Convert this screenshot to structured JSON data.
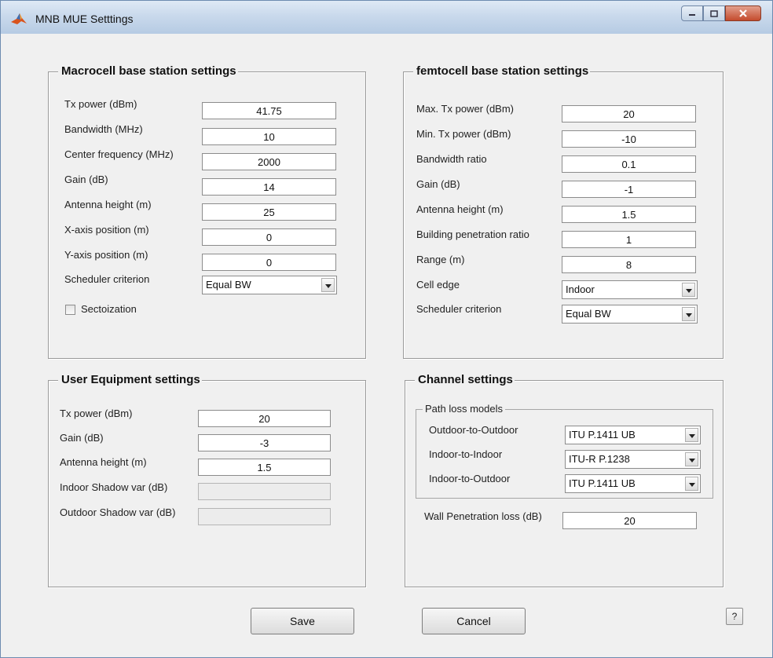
{
  "window": {
    "title": "MNB MUE Setttings",
    "icon": "matlab-logo-icon"
  },
  "macrocell": {
    "title": "Macrocell base station settings",
    "fields": [
      {
        "label": "Tx power (dBm)",
        "value": "41.75"
      },
      {
        "label": "Bandwidth (MHz)",
        "value": "10"
      },
      {
        "label": "Center frequency (MHz)",
        "value": "2000"
      },
      {
        "label": "Gain (dB)",
        "value": "14"
      },
      {
        "label": "Antenna height (m)",
        "value": "25"
      },
      {
        "label": "X-axis position (m)",
        "value": "0"
      },
      {
        "label": "Y-axis position (m)",
        "value": "0"
      }
    ],
    "scheduler": {
      "label": "Scheduler criterion",
      "value": "Equal BW"
    },
    "sectorization": {
      "label": "Sectoization",
      "checked": false
    }
  },
  "femtocell": {
    "title": "femtocell base station settings",
    "fields": [
      {
        "label": "Max. Tx power (dBm)",
        "value": "20"
      },
      {
        "label": "Min. Tx power (dBm)",
        "value": "-10"
      },
      {
        "label": "Bandwidth ratio",
        "value": "0.1"
      },
      {
        "label": "Gain (dB)",
        "value": "-1"
      },
      {
        "label": "Antenna height (m)",
        "value": "1.5"
      },
      {
        "label": "Building penetration ratio",
        "value": "1"
      },
      {
        "label": "Range (m)",
        "value": "8"
      }
    ],
    "cell_edge": {
      "label": "Cell edge",
      "value": "Indoor"
    },
    "scheduler": {
      "label": "Scheduler criterion",
      "value": "Equal BW"
    }
  },
  "ue": {
    "title": "User Equipment settings",
    "fields": [
      {
        "label": "Tx power (dBm)",
        "value": "20"
      },
      {
        "label": "Gain (dB)",
        "value": "-3"
      },
      {
        "label": "Antenna height (m)",
        "value": "1.5"
      },
      {
        "label": "Indoor Shadow var (dB)",
        "value": ""
      },
      {
        "label": "Outdoor Shadow var (dB)",
        "value": ""
      }
    ]
  },
  "channel": {
    "title": "Channel settings",
    "path_loss": {
      "title": "Path loss models",
      "models": [
        {
          "label": "Outdoor-to-Outdoor",
          "value": "ITU P.1411 UB"
        },
        {
          "label": "Indoor-to-Indoor",
          "value": "ITU-R P.1238"
        },
        {
          "label": "Indoor-to-Outdoor",
          "value": "ITU P.1411 UB"
        }
      ]
    },
    "wall_loss": {
      "label": "Wall Penetration loss (dB)",
      "value": "20"
    }
  },
  "buttons": {
    "save": "Save",
    "cancel": "Cancel",
    "help": "?"
  }
}
